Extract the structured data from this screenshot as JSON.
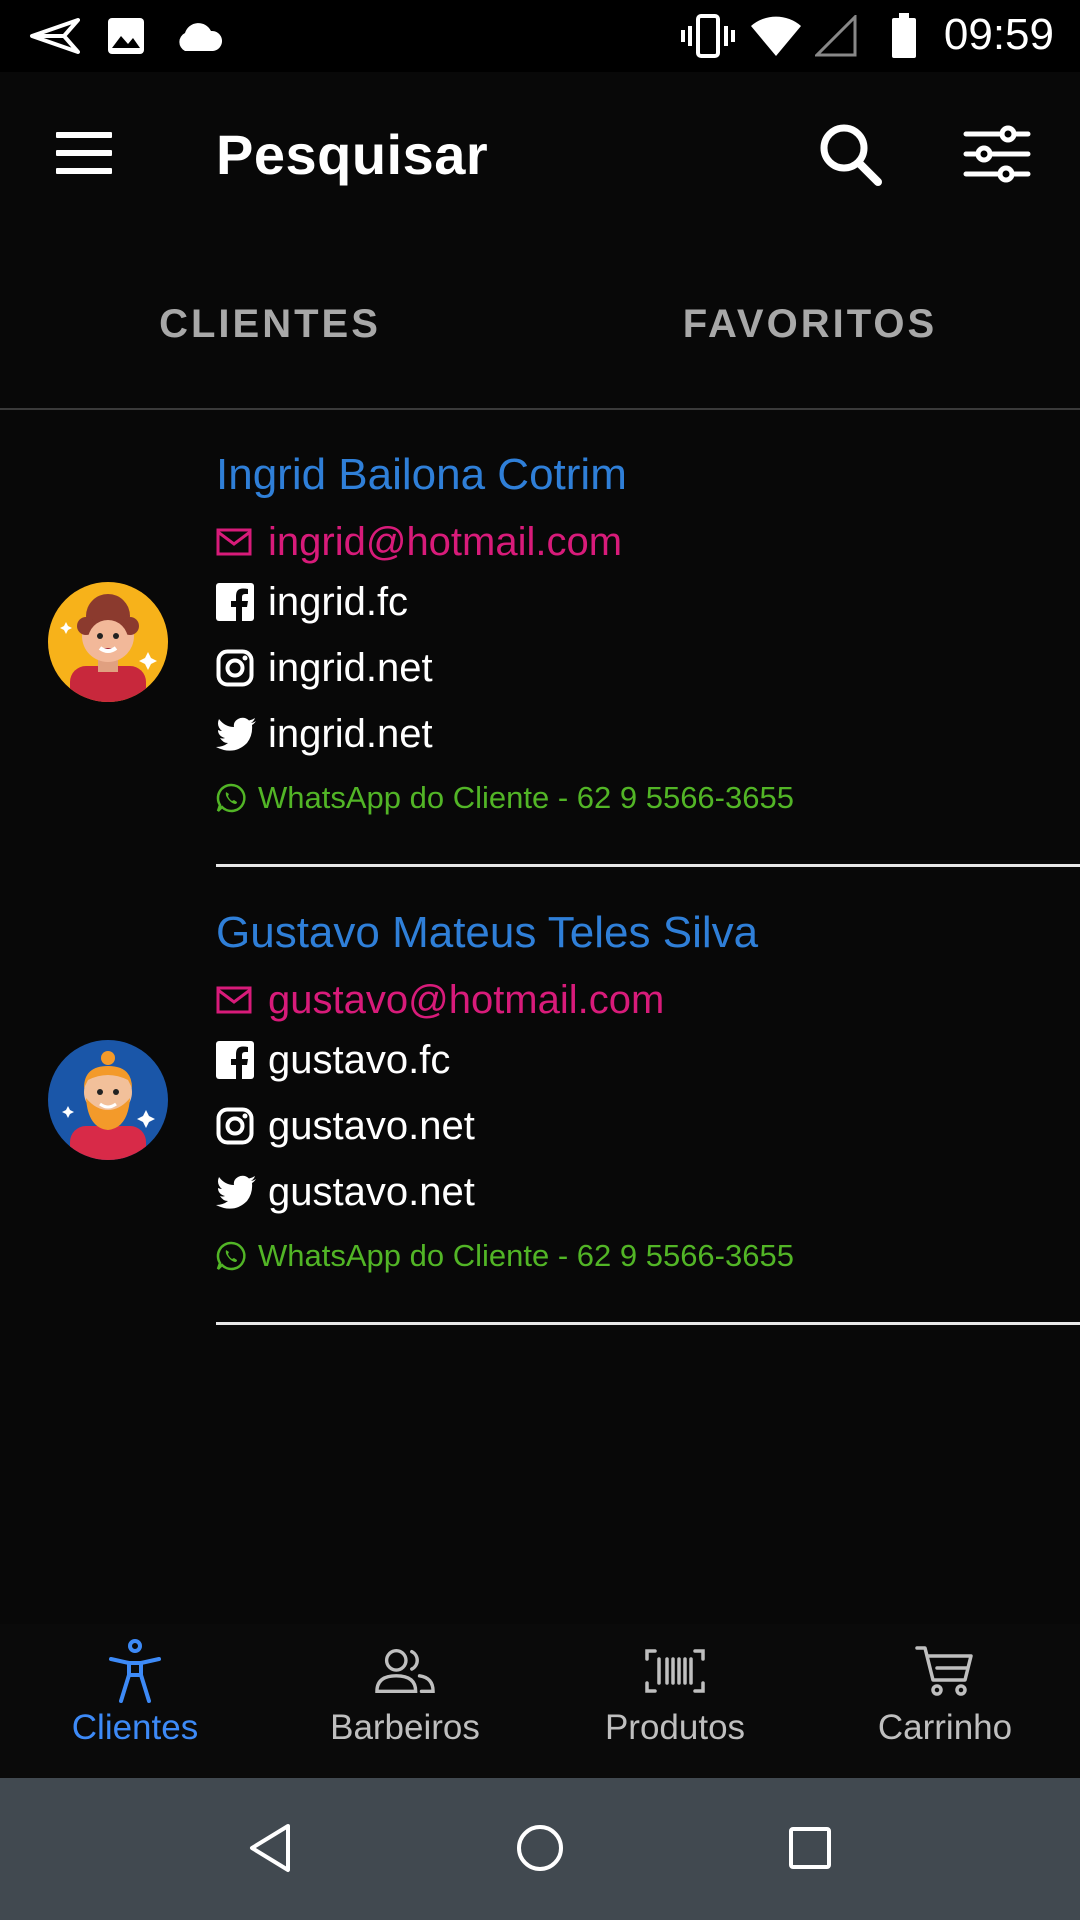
{
  "status_bar": {
    "time": "09:59",
    "icons": [
      "send-icon",
      "image-icon",
      "cloud-icon",
      "vibrate-icon",
      "wifi-icon",
      "signal-icon",
      "battery-icon"
    ]
  },
  "app_bar": {
    "title": "Pesquisar",
    "icons": [
      "menu-icon",
      "search-icon",
      "tune-icon"
    ]
  },
  "tabs": [
    {
      "label": "CLIENTES"
    },
    {
      "label": "FAVORITOS"
    }
  ],
  "clients": [
    {
      "name": "Ingrid Bailona Cotrim",
      "email": "ingrid@hotmail.com",
      "facebook": "ingrid.fc",
      "instagram": "ingrid.net",
      "twitter": "ingrid.net",
      "whatsapp": "WhatsApp do Cliente - 62 9 5566-3655"
    },
    {
      "name": "Gustavo Mateus Teles Silva",
      "email": "gustavo@hotmail.com",
      "facebook": "gustavo.fc",
      "instagram": "gustavo.net",
      "twitter": "gustavo.net",
      "whatsapp": "WhatsApp do Cliente - 62 9 5566-3655"
    }
  ],
  "bottom_nav": [
    {
      "label": "Clientes",
      "icon": "person-icon",
      "active": true
    },
    {
      "label": "Barbeiros",
      "icon": "people-icon",
      "active": false
    },
    {
      "label": "Produtos",
      "icon": "barcode-icon",
      "active": false
    },
    {
      "label": "Carrinho",
      "icon": "cart-icon",
      "active": false
    }
  ],
  "colors": {
    "background": "#080808",
    "name": "#2f7fd8",
    "email": "#d81b7a",
    "whatsapp": "#52b526",
    "active_nav": "#3d8af7",
    "system_nav": "#414950"
  }
}
